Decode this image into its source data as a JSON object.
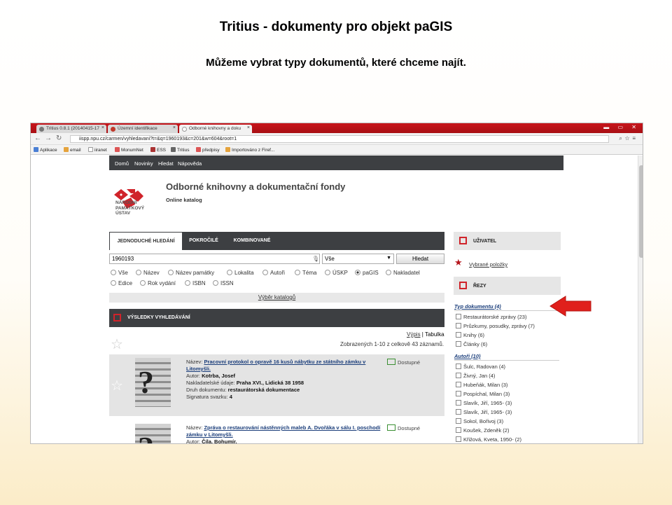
{
  "slide": {
    "title": "Tritius - dokumenty pro objekt paGIS",
    "subtitle": "Můžeme vybrat typy dokumentů, které chceme najít."
  },
  "browser": {
    "tabs": [
      {
        "label": "Tritius 0.8.1 (20140415-17"
      },
      {
        "label": "Územní identifikace"
      },
      {
        "label": "Odborné knihovny a doku"
      }
    ],
    "url": "iispp.npu.cz/carmen/vyhledavani?t=&q=1960193&c=201&w=604&root=1",
    "bookmarks": [
      "Aplikace",
      "email",
      "iiranet",
      "MonumNet",
      "ESS",
      "Tritius",
      "předpisy",
      "Importováno z Firef..."
    ]
  },
  "site": {
    "nav": [
      "Domů",
      "Novinky",
      "Hledat",
      "Nápověda"
    ],
    "logo_text": [
      "NÁRODNÍ",
      "PAMÁTKOVÝ",
      "ÚSTAV"
    ],
    "title": "Odborné knihovny a dokumentační fondy",
    "subtitle": "Online katalog"
  },
  "search": {
    "tabs": [
      "Jednoduché hledání",
      "Pokročilé",
      "Kombinované"
    ],
    "query": "1960193",
    "scope": "Vše",
    "button": "Hledat",
    "radios": [
      "Vše",
      "Název",
      "Název památky",
      "Lokalita",
      "Autoři",
      "Téma",
      "ÚSKP",
      "paGIS",
      "Nakladatel",
      "Edice",
      "Rok vydání",
      "ISBN",
      "ISSN"
    ],
    "selected": "paGIS",
    "catalog_link": "Výběr katalogů"
  },
  "results": {
    "heading": "Výsledky vyhledávání",
    "view_list": "Výpis",
    "view_table": "Tabulka",
    "count_text": "Zobrazených 1-10 z celkově 43 záznamů.",
    "records": [
      {
        "title_label": "Název:",
        "title": "Pracovní protokol o opravě 16 kusů nábytku ze státního zámku v Litomyšli.",
        "author_label": "Autor:",
        "author": "Kotrba, Josef",
        "publisher_label": "Nakladatelské údaje:",
        "publisher": "Praha XVI., Lidická 38 1958",
        "type_label": "Druh dokumentu:",
        "type": "restaurátorská dokumentace",
        "volume_label": "Signatura svazku:",
        "volume": "4",
        "availability": "Dostupné"
      },
      {
        "title_label": "Název:",
        "title": "Zpráva o restaurování nástěnných maleb A. Dvořáka v sálu I. poschodí zámku v Litomyšli.",
        "author_label": "Autor:",
        "author": "Číla, Bohumír,",
        "availability": "Dostupné"
      }
    ]
  },
  "sidebar": {
    "user_label": "Uživatel",
    "favorites": "Vybrané položky",
    "filters_label": "Řezy",
    "doc_type_heading": "Typ dokumentu (4)",
    "doc_types": [
      "Restaurátorské zprávy (23)",
      "Průzkumy, posudky, zprávy (7)",
      "Knihy (6)",
      "Články (6)"
    ],
    "authors_heading": "Autoři (10)",
    "authors": [
      "Šulc, Radovan (4)",
      "Živný, Jan (4)",
      "Hubeňák, Milan (3)",
      "Pospíchal, Milan (3)",
      "Slavík, Jiří, 1965- (3)",
      "Slavík, Jiří, 1965- (3)",
      "Sokol, Bořivoj (3)",
      "Koušek, Zdeněk (2)",
      "Křižová, Kveta, 1950- (2)"
    ]
  },
  "colors": {
    "brand_red": "#d0232a",
    "nav_dark": "#3d3f42",
    "arrow": "#e0201c"
  }
}
